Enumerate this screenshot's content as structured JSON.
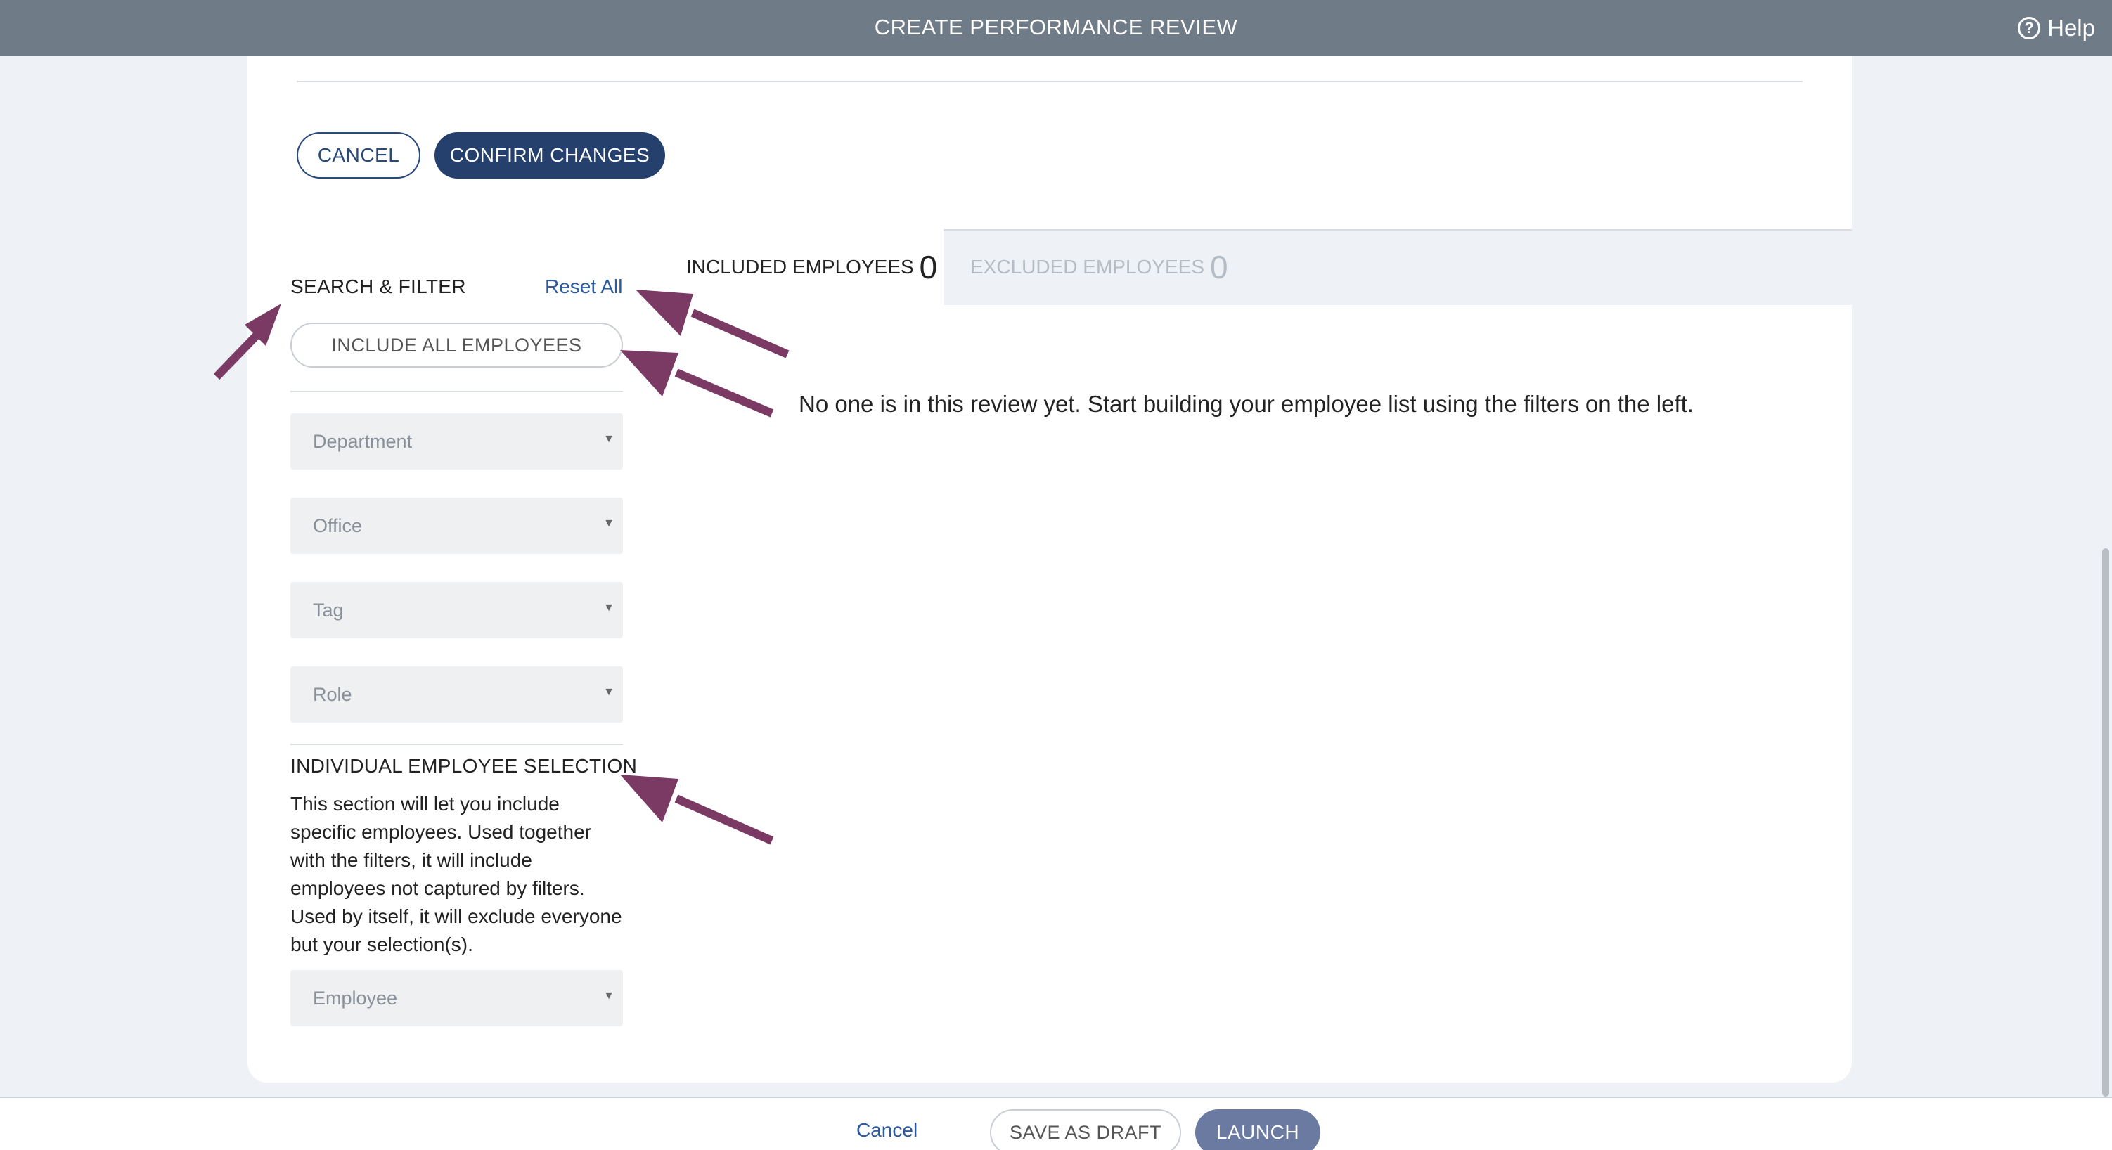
{
  "header": {
    "title": "CREATE PERFORMANCE REVIEW",
    "help_label": "Help",
    "help_icon_glyph": "?"
  },
  "actions": {
    "cancel_label": "CANCEL",
    "confirm_label": "CONFIRM CHANGES"
  },
  "tabs": [
    {
      "label": "INCLUDED EMPLOYEES",
      "count": "0",
      "active": true
    },
    {
      "label": "EXCLUDED EMPLOYEES",
      "count": "0",
      "active": false
    }
  ],
  "empty_message": "No one is in this review yet. Start building your employee list using the filters on the left.",
  "search_filter": {
    "title": "SEARCH & FILTER",
    "reset_label": "Reset All",
    "include_all_label": "INCLUDE ALL EMPLOYEES",
    "selects": [
      {
        "placeholder": "Department"
      },
      {
        "placeholder": "Office"
      },
      {
        "placeholder": "Tag"
      },
      {
        "placeholder": "Role"
      }
    ]
  },
  "individual_selection": {
    "title": "INDIVIDUAL EMPLOYEE SELECTION",
    "description": "This section will let you include specific employees. Used together with the filters, it will include employees not captured by filters. Used by itself, it will exclude everyone but your selection(s).",
    "select_placeholder": "Employee"
  },
  "footer": {
    "cancel_label": "Cancel",
    "save_draft_label": "SAVE AS DRAFT",
    "launch_label": "LAUNCH"
  },
  "colors": {
    "header_bg": "#6f7c88",
    "primary": "#25406d",
    "link": "#2a5aa0",
    "annotation_arrow": "#7a3a64",
    "launch_bg": "#6a7aa0"
  },
  "icons": [
    "help-circle-icon",
    "dropdown-caret-icon",
    "annotation-arrow"
  ]
}
